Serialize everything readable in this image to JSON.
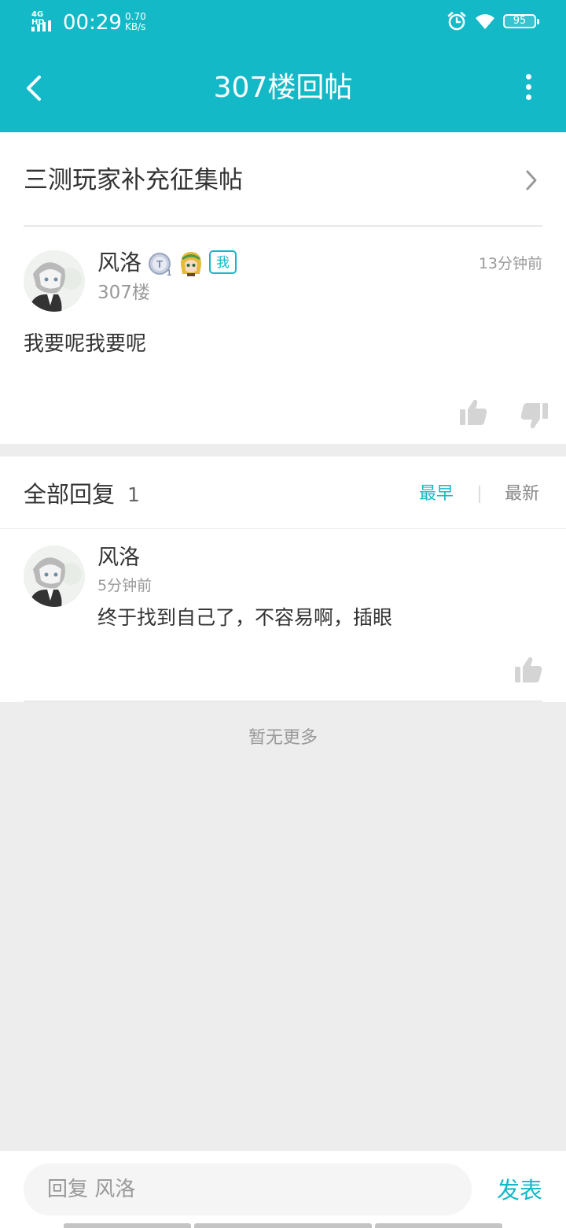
{
  "status_bar": {
    "network": "4G HD",
    "time": "00:29",
    "speed_value": "0.70",
    "speed_unit": "KB/s",
    "battery": "95"
  },
  "nav": {
    "title": "307楼回帖",
    "back_icon": "chevron-left-icon",
    "more_icon": "more-vertical-icon"
  },
  "thread": {
    "title": "三测玩家补充征集帖"
  },
  "post": {
    "username": "风洛",
    "level_badge": "T1",
    "me_badge": "我",
    "time": "13分钟前",
    "floor": "307楼",
    "content": "我要呢我要呢"
  },
  "replies": {
    "title": "全部回复",
    "count": "1",
    "sort_earliest": "最早",
    "sort_latest": "最新",
    "items": [
      {
        "username": "风洛",
        "time": "5分钟前",
        "content": "终于找到自己了，不容易啊，插眼"
      }
    ]
  },
  "footer": {
    "no_more": "暂无更多"
  },
  "bottom_bar": {
    "placeholder": "回复 风洛",
    "send_label": "发表"
  },
  "colors": {
    "accent": "#14b9c8",
    "background": "#ededed",
    "icon_gray": "#d4d4d4"
  }
}
